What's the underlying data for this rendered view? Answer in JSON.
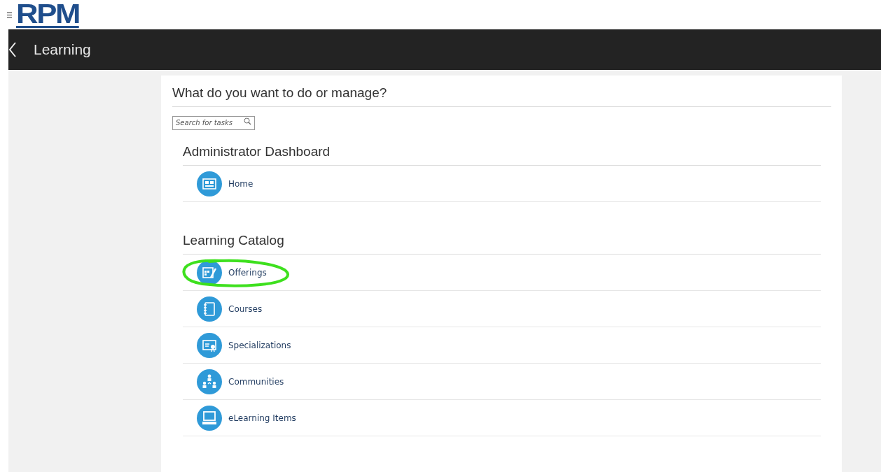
{
  "header": {
    "logo": "RPM"
  },
  "title_bar": {
    "title": "Learning"
  },
  "panel": {
    "heading": "What do you want to do or manage?",
    "search": {
      "placeholder": "Search for tasks"
    },
    "sections": [
      {
        "title": "Administrator Dashboard",
        "items": [
          {
            "label": "Home",
            "kind": "dashboard",
            "circled": false
          }
        ]
      },
      {
        "title": "Learning Catalog",
        "items": [
          {
            "label": "Offerings",
            "kind": "calendar",
            "circled": true
          },
          {
            "label": "Courses",
            "kind": "notebook",
            "circled": false
          },
          {
            "label": "Specializations",
            "kind": "certificate",
            "circled": false
          },
          {
            "label": "Communities",
            "kind": "people",
            "circled": false
          },
          {
            "label": "eLearning Items",
            "kind": "computer",
            "circled": false
          }
        ]
      }
    ]
  }
}
